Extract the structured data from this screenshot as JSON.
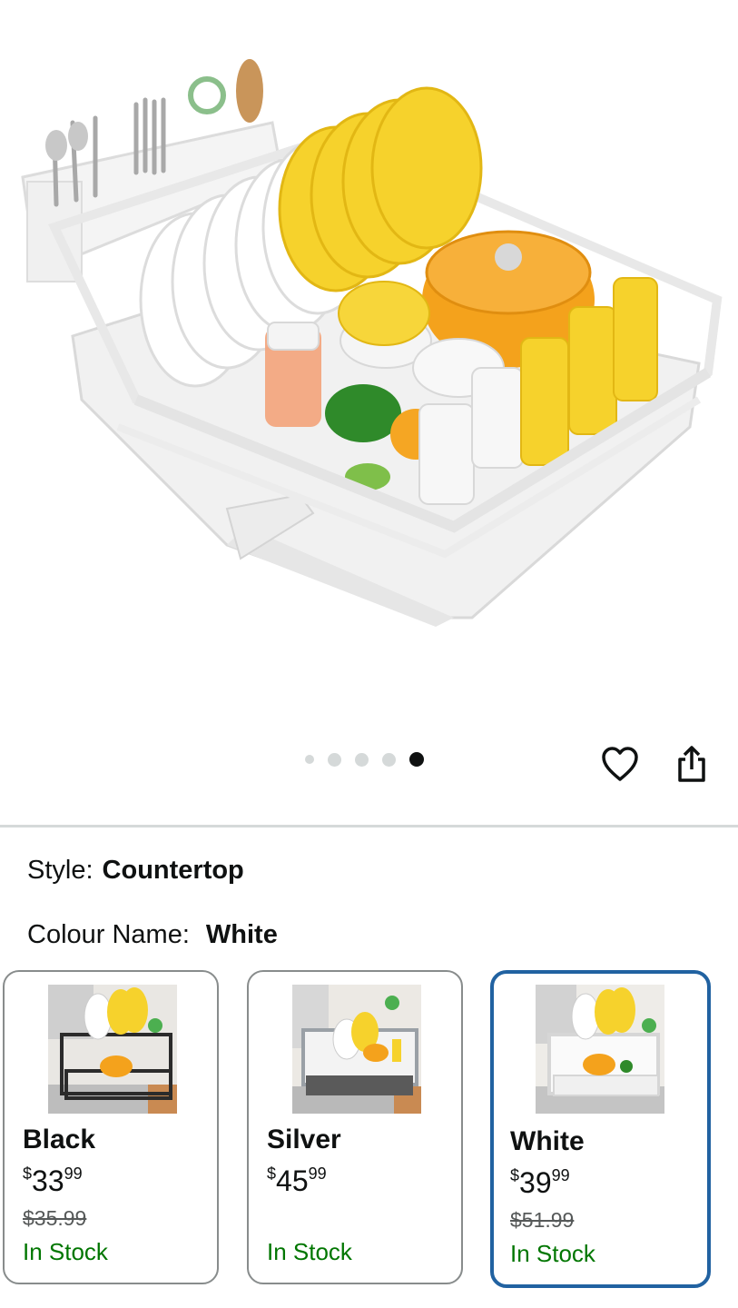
{
  "product": {
    "image_alt": "White dish drying rack with plates, bowls, cups and utensil holder",
    "carousel": {
      "total": 5,
      "active": 5
    }
  },
  "icons": {
    "wishlist": "heart-outline-icon",
    "share": "share-icon"
  },
  "selectors": {
    "style_label": "Style:",
    "style_value": "Countertop",
    "colour_label": "Colour Name:",
    "colour_value": "White"
  },
  "variants": [
    {
      "name": "Black",
      "price_currency": "$",
      "price_whole": "33",
      "price_fraction": "99",
      "was_price": "$35.99",
      "stock": "In Stock",
      "theme": "#2b2b2b"
    },
    {
      "name": "Silver",
      "price_currency": "$",
      "price_whole": "45",
      "price_fraction": "99",
      "was_price": "",
      "stock": "In Stock",
      "theme": "#9aa0a6"
    },
    {
      "name": "White",
      "price_currency": "$",
      "price_whole": "39",
      "price_fraction": "99",
      "was_price": "$51.99",
      "stock": "In Stock",
      "theme": "#f2f2f2",
      "selected": true
    }
  ],
  "colors": {
    "selected_border": "#2162a1",
    "in_stock": "#007600",
    "card_border": "#888c8c"
  }
}
